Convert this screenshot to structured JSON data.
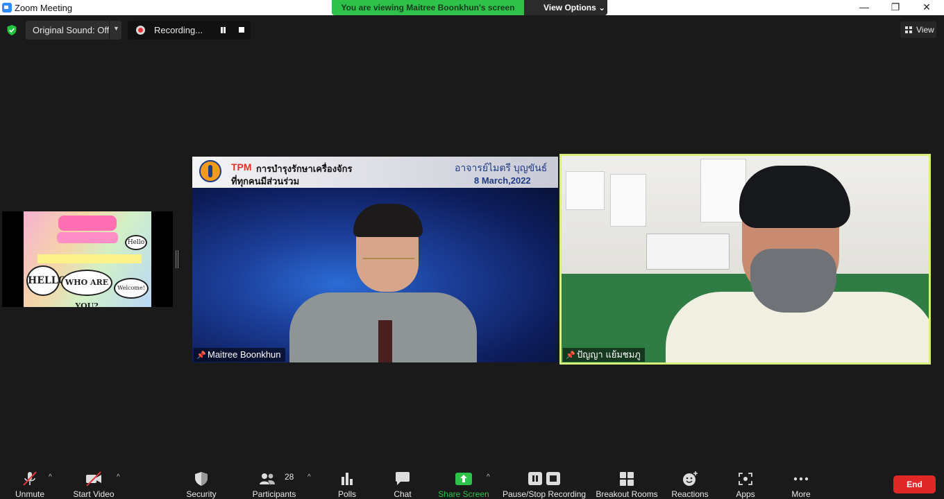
{
  "window": {
    "title": "Zoom Meeting",
    "controls": {
      "minimize": "—",
      "maximize": "❐",
      "close": "✕"
    }
  },
  "banner": {
    "viewing_text": "You are viewing Maitree Boonkhun's screen",
    "view_options": "View Options",
    "accent_color": "#2fc24a"
  },
  "top_toolbar": {
    "original_sound": "Original Sound: Off",
    "recording": "Recording...",
    "view": "View"
  },
  "tiles": {
    "slide": {
      "bubbles": [
        "Hello",
        "HELLO!",
        "WHO ARE YOU?",
        "Welcome!"
      ]
    },
    "maitree": {
      "header_tpm": "TPM",
      "header_line1": "การบำรุงรักษาเครื่องจักร",
      "header_line2": "ที่ทุกคนมีส่วนร่วม",
      "teacher": "อาจารย์ไมตรี บุญขันธ์",
      "date": "8 March,2022",
      "name": "Maitree Boonkhun"
    },
    "panya": {
      "name": "ปัญญา แย้มชมภู",
      "highlight_color": "#d6f07a"
    }
  },
  "bottom_toolbar": {
    "unmute": "Unmute",
    "start_video": "Start Video",
    "security": "Security",
    "participants": "Participants",
    "participants_count": "28",
    "polls": "Polls",
    "chat": "Chat",
    "share_screen": "Share Screen",
    "pause_stop_recording": "Pause/Stop Recording",
    "breakout_rooms": "Breakout Rooms",
    "reactions": "Reactions",
    "apps": "Apps",
    "more": "More",
    "end": "End",
    "end_color": "#e02828"
  }
}
